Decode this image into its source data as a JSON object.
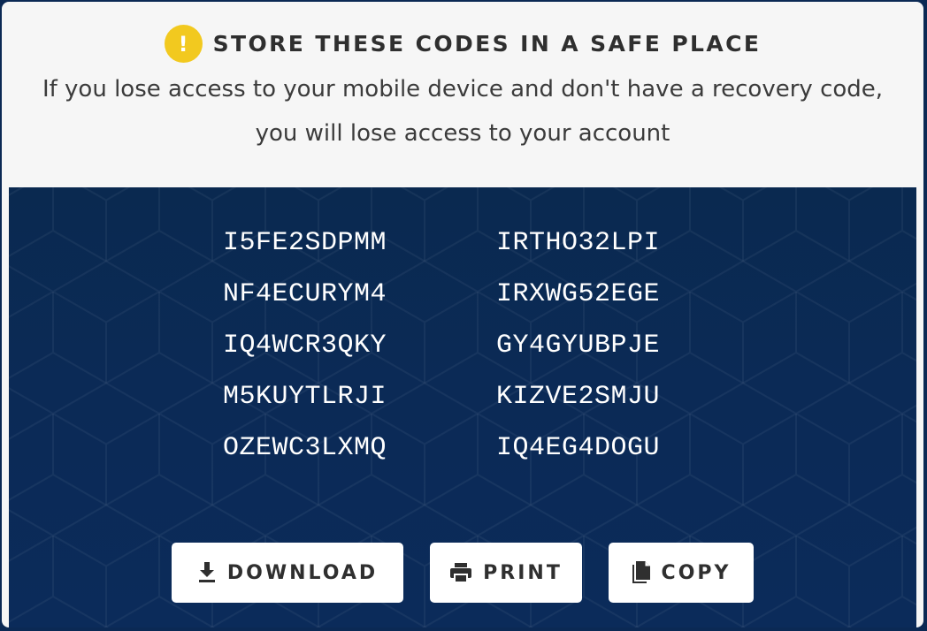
{
  "warning": {
    "icon": "exclamation-icon",
    "icon_glyph": "!",
    "title": "STORE THESE CODES IN A SAFE PLACE",
    "message": "If you lose access to your mobile device and don't have a recovery code, you will lose access to your account"
  },
  "codes": {
    "left": [
      "I5FE2SDPMM",
      "NF4ECURYM4",
      "IQ4WCR3QKY",
      "M5KUYTLRJI",
      "OZEWC3LXMQ"
    ],
    "right": [
      "IRTHO32LPI",
      "IRXWG52EGE",
      "GY4GYUBPJE",
      "KIZVE2SMJU",
      "IQ4EG4DOGU"
    ]
  },
  "actions": {
    "download": {
      "label": "DOWNLOAD",
      "icon": "download-icon"
    },
    "print": {
      "label": "PRINT",
      "icon": "printer-icon"
    },
    "copy": {
      "label": "COPY",
      "icon": "copy-icon"
    }
  },
  "colors": {
    "accent_warning": "#f2c91f",
    "panel_background": "#0b2a56",
    "header_background": "#f6f6f6"
  }
}
